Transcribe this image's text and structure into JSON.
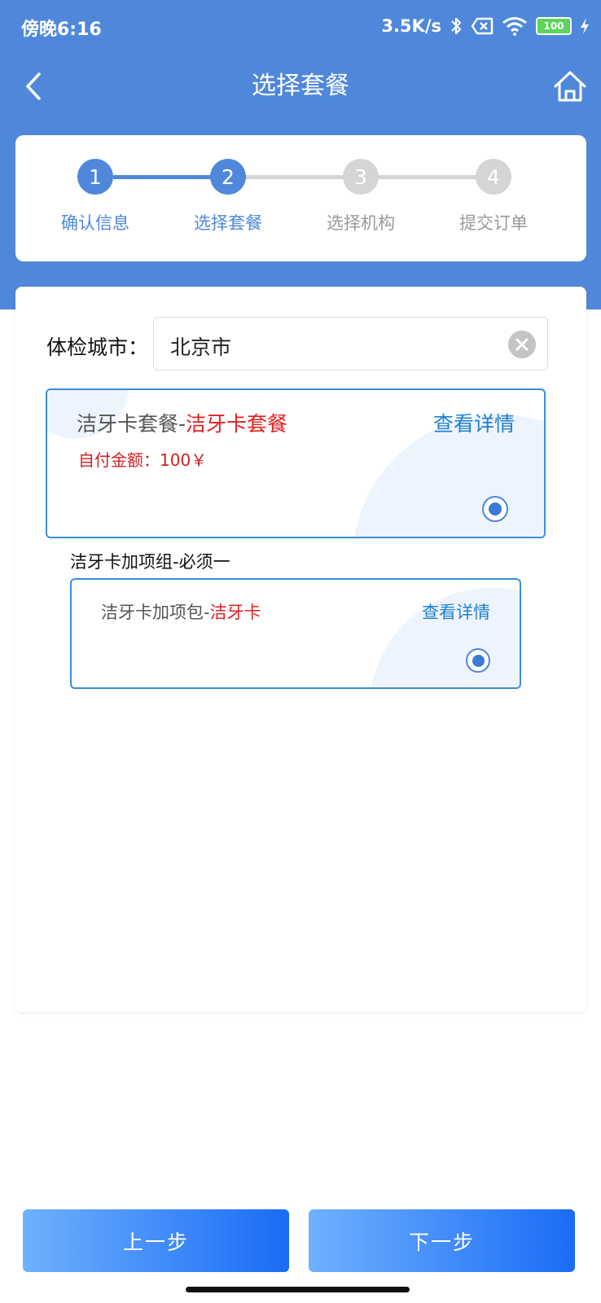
{
  "status_bar": {
    "time": "傍晚6:16",
    "speed": "3.5K/s",
    "battery": "100",
    "icons": [
      "bluetooth-icon",
      "no-sim-icon",
      "wifi-icon",
      "battery-icon",
      "charging-icon"
    ]
  },
  "nav": {
    "title": "选择套餐",
    "back_icon": "back-arrow-icon",
    "home_icon": "home-icon"
  },
  "stepper": {
    "active_color": "#4f88db",
    "inactive_color": "#d5d5d5",
    "steps": [
      {
        "number": "1",
        "label": "确认信息",
        "state": "done"
      },
      {
        "number": "2",
        "label": "选择套餐",
        "state": "active"
      },
      {
        "number": "3",
        "label": "选择机构",
        "state": "pending"
      },
      {
        "number": "4",
        "label": "提交订单",
        "state": "pending"
      }
    ]
  },
  "city": {
    "label": "体检城市：",
    "value": "北京市",
    "clear_icon": "clear-icon"
  },
  "package": {
    "prefix": "洁牙卡套餐-",
    "name": "洁牙卡套餐",
    "price_text": "自付金额：100￥",
    "detail_label": "查看详情",
    "selected": true
  },
  "addon_group": {
    "title": "洁牙卡加项组-必须一",
    "items": [
      {
        "prefix": "洁牙卡加项包-",
        "name": "洁牙卡",
        "detail_label": "查看详情",
        "selected": true
      }
    ]
  },
  "footer": {
    "prev_label": "上一步",
    "next_label": "下一步"
  },
  "colors": {
    "header": "#4f88db",
    "accent_red": "#e02020",
    "link_blue": "#1f7fd0",
    "card_border": "#3b8ed6"
  }
}
